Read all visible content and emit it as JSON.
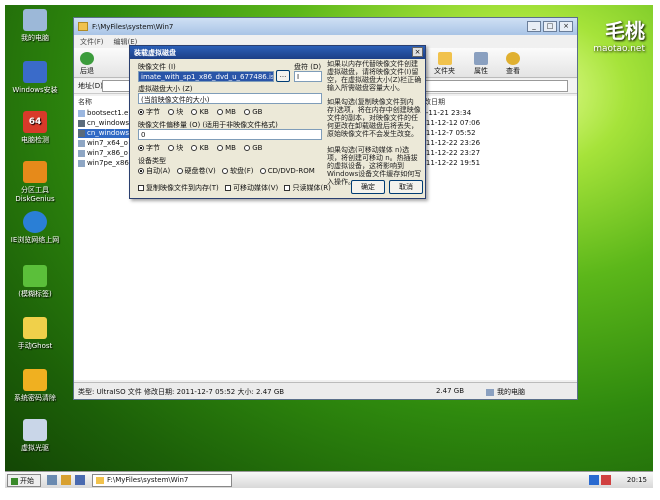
{
  "watermark": {
    "brand": "毛桃",
    "site": "maotao.net"
  },
  "desktop_icons": [
    {
      "name": "my-computer",
      "label": "我的电脑",
      "color": "#9cb8d8"
    },
    {
      "name": "windows-install",
      "label": "Windows安装",
      "color": "#3a6bc9"
    },
    {
      "name": "check-64",
      "label": "电脑检测",
      "color": "#d83a2a"
    },
    {
      "name": "diskgenius",
      "label": "分区工具 DiskGenius",
      "color": "#e68a1a"
    },
    {
      "name": "network-browser",
      "label": "IE浏览网络上网",
      "color": "#2a7fd6"
    },
    {
      "name": "onekey-restore",
      "label": "(模糊标签)",
      "color": "#5bbf3a"
    },
    {
      "name": "ghost-manual",
      "label": "手动Ghost",
      "color": "#f0d04a"
    },
    {
      "name": "password-clear",
      "label": "系统密码清除",
      "color": "#f0b020"
    },
    {
      "name": "virtual-drive",
      "label": "虚拟光驱",
      "color": "#c9d6e8"
    }
  ],
  "explorer": {
    "title": "F:\\MyFiles\\system\\Win7",
    "menu": [
      "文件(F)",
      "编辑(E)"
    ],
    "toolbar": {
      "back": "后退",
      "folders": "文件夹",
      "properties": "属性",
      "view": "查看"
    },
    "address_label": "地址(D)",
    "column_name": "名称",
    "column_date": "修改日期",
    "files": [
      {
        "name": "bootsect1.e",
        "date": "20-11-21 23:34"
      },
      {
        "name": "cn_windows",
        "date": "2011-12-12 07:06"
      },
      {
        "name": "cn_windows",
        "date": "2011-12-7 05:52"
      },
      {
        "name": "win7_x64_o",
        "date": "2011-12-22 23:26"
      },
      {
        "name": "win7_x86_o",
        "date": "2011-12-22 23:27"
      },
      {
        "name": "win7pe_x86",
        "date": "2011-12-22 19:51"
      }
    ],
    "status_text": "类型: UltraISO 文件 修改日期: 2011-12-7 05:52 大小: 2.47 GB",
    "status_size": "2.47 GB",
    "status_location": "我的电脑"
  },
  "dialog": {
    "title": "装载虚拟磁盘",
    "image_label": "映像文件 (I)",
    "image_value": "imate_with_sp1_x86_dvd_u_677486.iso",
    "browse_label": "...",
    "drive_label": "盘符 (D)",
    "drive_value": "I",
    "size_label": "虚拟磁盘大小 (Z)",
    "size_placeholder": "(当前映像文件的大小)",
    "units": [
      "字节",
      "块",
      "KB",
      "MB",
      "GB"
    ],
    "offset_label": "映像文件偏移量 (O) (适用于非映像文件格式)",
    "offset_value": "0",
    "devtype_label": "设备类型",
    "devtypes": [
      "自动(A)",
      "硬盘卷(V)",
      "软盘(F)",
      "CD/DVD-ROM"
    ],
    "options": [
      "复制映像文件到内存(T)",
      "可移动媒体(V)",
      "只读媒体(R)"
    ],
    "ok": "确定",
    "cancel": "取消",
    "help1": "如果以内存代替映像文件创建虚拟磁盘，请将映像文件(I)留空，在虚拟磁盘大小(Z)栏正确输入所需磁盘容量大小。",
    "help2": "如果勾选(复制映像文件到内存)选项，将在内存中创建映像文件的副本，对映像文件的任何更改在卸载磁盘后将丢失，原始映像文件不会发生改变。",
    "help3": "如果勾选(可移动媒体 n)选项，将创建可移动 n。热插拔的虚拟设备，这将影响到Windows设备文件缓存如何写入操作。"
  },
  "taskbar": {
    "start": "开始",
    "task": "F:\\MyFiles\\system\\Win7",
    "time": "20:15"
  }
}
